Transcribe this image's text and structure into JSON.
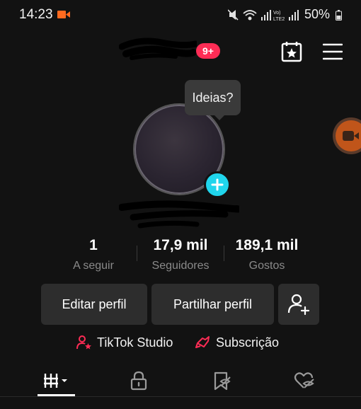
{
  "status_bar": {
    "time": "14:23",
    "battery_percent": "50%",
    "network_label": "Vo) LTE2"
  },
  "header": {
    "notification_count": "9+"
  },
  "profile": {
    "tooltip": "Ideias?"
  },
  "stats": [
    {
      "value": "1",
      "label": "A seguir"
    },
    {
      "value": "17,9 mil",
      "label": "Seguidores"
    },
    {
      "value": "189,1 mil",
      "label": "Gostos"
    }
  ],
  "actions": {
    "edit_profile": "Editar perfil",
    "share_profile": "Partilhar perfil"
  },
  "links": {
    "studio": "TikTok Studio",
    "subscription": "Subscrição"
  },
  "tabs": [
    {
      "icon": "grid-icon",
      "selected": true
    },
    {
      "icon": "lock-icon",
      "selected": false
    },
    {
      "icon": "saved-icon",
      "selected": false
    },
    {
      "icon": "liked-icon",
      "selected": false
    }
  ],
  "colors": {
    "accent_red": "#fe2c55",
    "accent_cyan": "#20d5ec",
    "recording_orange": "#ff6a1f",
    "background": "#121212",
    "button_bg": "#2d2d2d"
  }
}
